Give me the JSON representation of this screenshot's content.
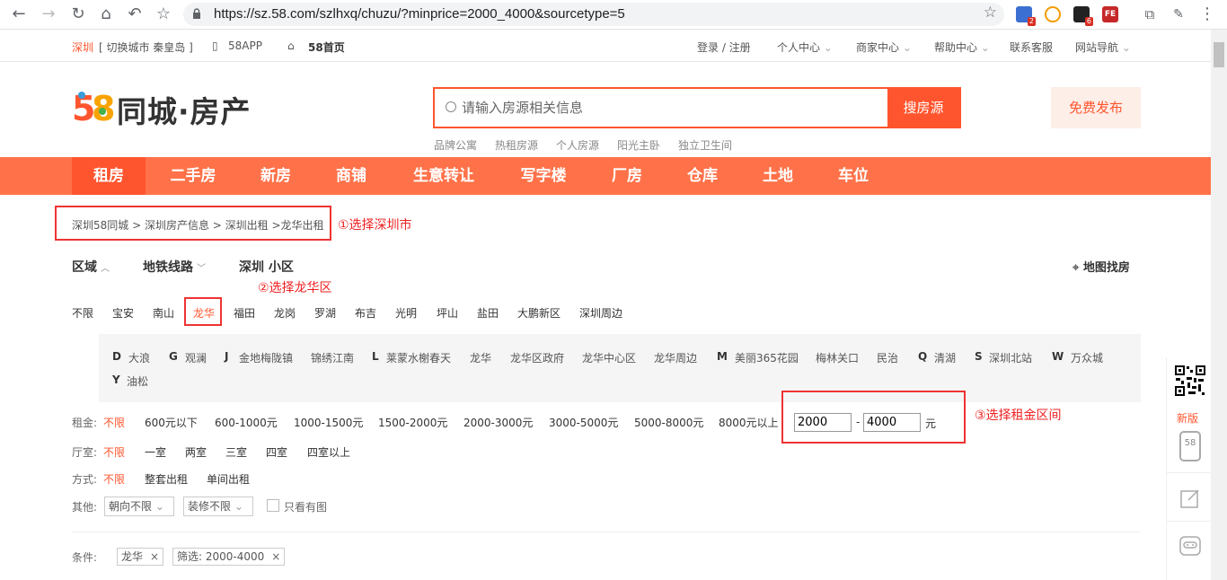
{
  "browser": {
    "url": "https://sz.58.com/szlhxq/chuzu/?minprice=2000_4000&sourcetype=5",
    "badges": [
      "2",
      "6"
    ]
  },
  "topbar": {
    "city": "深圳",
    "switch_city": "[ 切换城市  秦皇岛 ]",
    "app": "58APP",
    "home": "58首页",
    "login": "登录 / 注册",
    "personal": "个人中心",
    "merchant": "商家中心",
    "help": "帮助中心",
    "service": "联系客服",
    "sitenav": "网站导航"
  },
  "header": {
    "logo_num": "58",
    "logo_text": "同城·房产",
    "search_placeholder": "请输入房源相关信息",
    "search_button": "搜房源",
    "post_button": "免费发布",
    "hot_links": [
      "品牌公寓",
      "热租房源",
      "个人房源",
      "阳光主卧",
      "独立卫生间"
    ]
  },
  "nav": {
    "items": [
      "租房",
      "二手房",
      "新房",
      "商铺",
      "生意转让",
      "写字楼",
      "厂房",
      "仓库",
      "土地",
      "车位"
    ]
  },
  "breadcrumb": "深圳58同城 > 深圳房产信息 > 深圳出租 >龙华出租",
  "annotations": {
    "a1": "①选择深圳市",
    "a2": "②选择龙华区",
    "a3": "③选择租金区间"
  },
  "filter_tabs": {
    "area": "区域",
    "metro": "地铁线路",
    "community": "深圳 小区",
    "map": "地图找房"
  },
  "districts": [
    "不限",
    "宝安",
    "南山",
    "龙华",
    "福田",
    "龙岗",
    "罗湖",
    "布吉",
    "光明",
    "坪山",
    "盐田",
    "大鹏新区",
    "深圳周边"
  ],
  "subareas": {
    "D": "D",
    "dalang": "大浪",
    "G": "G",
    "guanlan": "观澜",
    "J": "J",
    "jinde": "金地梅陇镇",
    "jinxiu": "锦绣江南",
    "L": "L",
    "laimeng": "莱蒙水榭春天",
    "longhua": "龙华",
    "lhgov": "龙华区政府",
    "lhcenter": "龙华中心区",
    "lharound": "龙华周边",
    "M": "M",
    "meili": "美丽365花园",
    "meilin": "梅林关口",
    "minzhi": "民治",
    "Q": "Q",
    "qinghu": "清湖",
    "S": "S",
    "szbei": "深圳北站",
    "W": "W",
    "wanzhong": "万众城",
    "Y": "Y",
    "yousong": "油松"
  },
  "rent": {
    "label": "租金:",
    "options": [
      "不限",
      "600元以下",
      "600-1000元",
      "1000-1500元",
      "1500-2000元",
      "2000-3000元",
      "3000-5000元",
      "5000-8000元",
      "8000元以上"
    ],
    "min": "2000",
    "dash": "-",
    "max": "4000",
    "unit": "元"
  },
  "rooms": {
    "label": "厅室:",
    "options": [
      "不限",
      "一室",
      "两室",
      "三室",
      "四室",
      "四室以上"
    ]
  },
  "mode": {
    "label": "方式:",
    "options": [
      "不限",
      "整套出租",
      "单间出租"
    ]
  },
  "other": {
    "label": "其他:",
    "orientation": "朝向不限",
    "decoration": "装修不限",
    "photo_only": "只看有图"
  },
  "conditions": {
    "label": "条件:",
    "tags": [
      "龙华",
      "筛选: 2000-4000"
    ],
    "close": "×"
  },
  "side": {
    "new_version": "新版",
    "phone_58": "58"
  },
  "colors": {
    "brand": "#ff552e",
    "nav": "#ff7249",
    "annotation": "#e22222"
  }
}
